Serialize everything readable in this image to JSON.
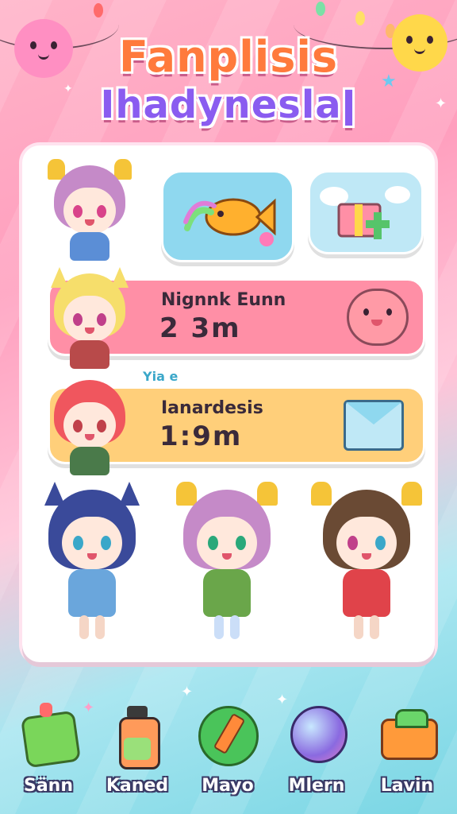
{
  "title": {
    "line1": "Fanplisis",
    "line2": "Ihadyneslaǀ"
  },
  "cards": {
    "row1": {
      "name": "Nignnk Eunn",
      "time": "2 3m",
      "color": "#ff8fa6"
    },
    "row2": {
      "name": "Ianardesis",
      "time": "1:9m",
      "color": "#ffcf7a",
      "tag": "Yia e"
    }
  },
  "nav": {
    "items": [
      {
        "label": "Sänn",
        "icon": "green-block-icon"
      },
      {
        "label": "Kaned",
        "icon": "potion-bottle-icon"
      },
      {
        "label": "Mayo",
        "icon": "paint-pen-icon"
      },
      {
        "label": "Mlern",
        "icon": "balloon-icon"
      },
      {
        "label": "Lavin",
        "icon": "treasure-chest-icon"
      }
    ]
  },
  "colors": {
    "accent_pink": "#ff8fa6",
    "accent_yellow": "#ffcf7a",
    "accent_blue": "#8fd8ef",
    "title_orange": "#ff7a3c"
  }
}
